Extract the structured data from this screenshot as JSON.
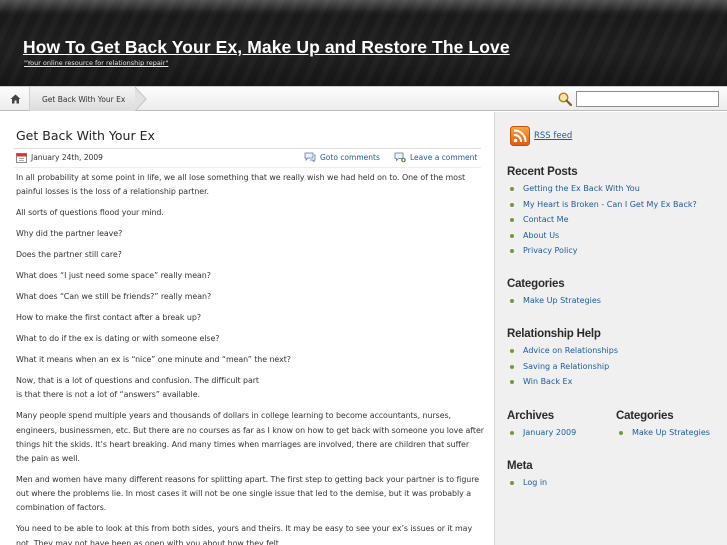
{
  "header": {
    "title": "How To Get Back Your Ex, Make Up and Restore The Love",
    "tagline": "\"Your online resource for relationship repair\""
  },
  "nav": {
    "current": "Get Back With Your Ex",
    "search_value": ""
  },
  "post": {
    "title": "Get Back With Your Ex",
    "date": "January 24th, 2009",
    "comments_link": "Goto comments",
    "leave_comment": "Leave a comment",
    "paragraphs": [
      "In all probability at some point in life, we all lose something that we really wish we had held on to. One of the most painful losses is the loss of a relationship partner.",
      "All sorts of questions flood your mind.",
      "Why did the partner leave?",
      "Does the partner still care?",
      "What does “I just need some space” really mean?",
      "What does “Can we still be friends?” really mean?",
      "How to make the first contact after a break up?",
      "What to do if the ex is dating or with someone else?",
      "What it means when an ex is “nice” one minute and “mean” the next?",
      "Now, that is a lot of questions and confusion. The difficult part\nis that there is not a lot of “answers” available.",
      "Many people spend multiple years and thousands of dollars in college learning to become accountants, nurses, engineers, businessmen, etc. But there are no courses as far as I know on how to get back with someone you love after things hit the skids. It’s heart breaking. And many times when marriages are involved, there are children that suffer the pain as well.",
      "Men and women have many different reasons for splitting apart. The first step to getting back your partner is to figure out where the problems lie. In most cases it will not be one single issue that led to the demise, but it was probably a combination of factors.",
      "You need to be able to look at this from both sides, yours and theirs. It may be easy to see your ex’s issues or it may not. They may not have been as open with you about how they felt."
    ]
  },
  "sidebar": {
    "rss": "RSS feed",
    "recent_posts": {
      "heading": "Recent Posts",
      "items": [
        "Getting the Ex Back With You",
        "My Heart is Broken - Can I Get My Ex Back?",
        "Contact Me",
        "About Us",
        "Privacy Policy"
      ]
    },
    "categories": {
      "heading": "Categories",
      "items": [
        "Make Up Strategies"
      ]
    },
    "relationship_help": {
      "heading": "Relationship Help",
      "items": [
        "Advice on Relationships",
        "Saving a Relationship",
        "Win Back Ex"
      ]
    },
    "archives": {
      "heading": "Archives",
      "items": [
        "January 2009"
      ]
    },
    "categories2": {
      "heading": "Categories",
      "items": [
        "Make Up Strategies"
      ]
    },
    "meta": {
      "heading": "Meta",
      "items": [
        "Log in"
      ]
    }
  },
  "colors": {
    "link": "#1e5a9a",
    "bullet": "#6b9e3a",
    "rss_orange": "#f07a1a"
  }
}
